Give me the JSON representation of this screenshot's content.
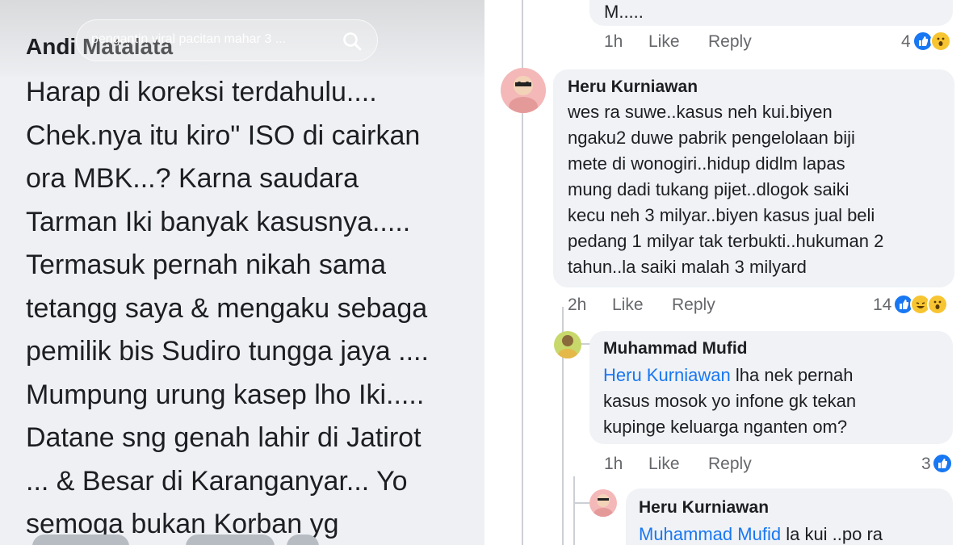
{
  "left_post": {
    "search_query": "pengantin viral pacitan mahar 3 ...",
    "author": "Andi Matalata",
    "lines": [
      "Harap di koreksi terdahulu....",
      "Chek.nya itu kiro\" ISO di cairkan",
      "ora MBK...? Karna saudara",
      "Tarman Iki banyak kasusnya.....",
      "Termasuk pernah nikah sama",
      "tetangg saya & mengaku sebaga",
      "pemilik bis Sudiro tungga jaya ....",
      "Mumpung urung kasep lho Iki.....",
      "Datane sng genah lahir di Jatirot",
      "... & Besar di Karanganyar... Yo",
      "semoga bukan Korban yg"
    ]
  },
  "comments": {
    "c0": {
      "text_tail": "M.....",
      "time": "1h",
      "like": "Like",
      "reply": "Reply",
      "count": "4"
    },
    "c1": {
      "name": "Heru Kurniawan",
      "lines": [
        "wes ra suwe..kasus neh kui.biyen",
        "ngaku2 duwe pabrik pengelolaan biji",
        "mete di wonogiri..hidup didlm lapas",
        "mung dadi tukang pijet..dlogok saiki",
        "kecu neh 3 milyar..biyen kasus jual beli",
        "pedang 1 milyar tak terbukti..hukuman 2",
        "tahun..la saiki malah 3 milyard"
      ],
      "time": "2h",
      "like": "Like",
      "reply": "Reply",
      "count": "14"
    },
    "c2": {
      "name": "Muhammad Mufid",
      "mention": "Heru Kurniawan",
      "line1_rest": "lha nek pernah",
      "lines": [
        "kasus mosok yo infone gk tekan",
        "kupinge keluarga nganten om?"
      ],
      "time": "1h",
      "like": "Like",
      "reply": "Reply",
      "count": "3"
    },
    "c3": {
      "name": "Heru Kurniawan",
      "mention": "Muhammad Mufid",
      "line1_rest": "la kui ..po ra"
    }
  },
  "colors": {
    "link_blue": "#1877f2",
    "bubble_bg": "#f0f2f5",
    "meta_gray": "#65676b",
    "text_dark": "#1c1e21"
  },
  "icons": [
    "search-icon",
    "like-reaction-icon",
    "haha-reaction-icon",
    "wow-reaction-icon"
  ]
}
